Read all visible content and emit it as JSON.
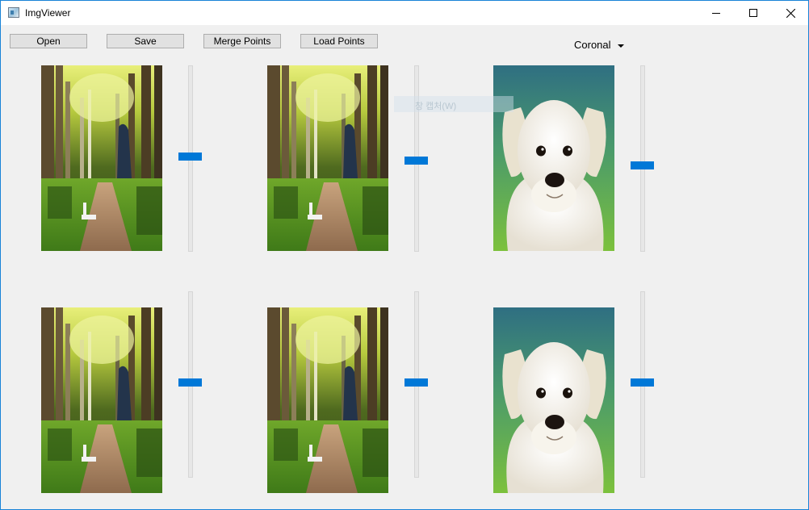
{
  "window": {
    "title": "ImgViewer"
  },
  "toolbar": {
    "open_label": "Open",
    "save_label": "Save",
    "merge_label": "Merge Points",
    "load_label": "Load Points"
  },
  "view_select": {
    "value": "Coronal"
  },
  "ghost_tooltip": "창 캡처(W)",
  "images": [
    {
      "subject": "forest path with bench",
      "slider_level": 0.49
    },
    {
      "subject": "forest path with bench",
      "slider_level": 0.51
    },
    {
      "subject": "white puppy",
      "slider_level": 0.54
    },
    {
      "subject": "forest path with bench",
      "slider_level": 0.49
    },
    {
      "subject": "forest path with bench",
      "slider_level": 0.49
    },
    {
      "subject": "white puppy",
      "slider_level": 0.49
    }
  ],
  "colors": {
    "accent": "#0078d7",
    "window_border": "#1883d7"
  }
}
